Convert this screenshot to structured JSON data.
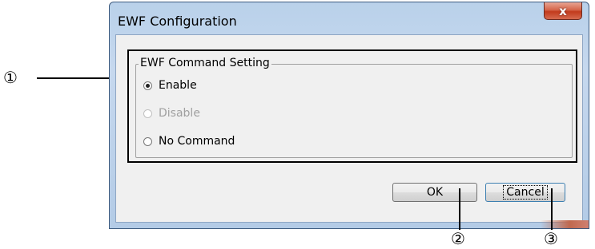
{
  "window": {
    "title": "EWF Configuration",
    "close_glyph": "x"
  },
  "group": {
    "legend": "EWF Command Setting",
    "options": [
      {
        "label": "Enable",
        "checked": true,
        "disabled": false
      },
      {
        "label": "Disable",
        "checked": false,
        "disabled": true
      },
      {
        "label": "No Command",
        "checked": false,
        "disabled": false
      }
    ]
  },
  "buttons": {
    "ok_label": "OK",
    "cancel_label": "Cancel"
  },
  "callouts": {
    "one": "①",
    "two": "②",
    "three": "③"
  }
}
